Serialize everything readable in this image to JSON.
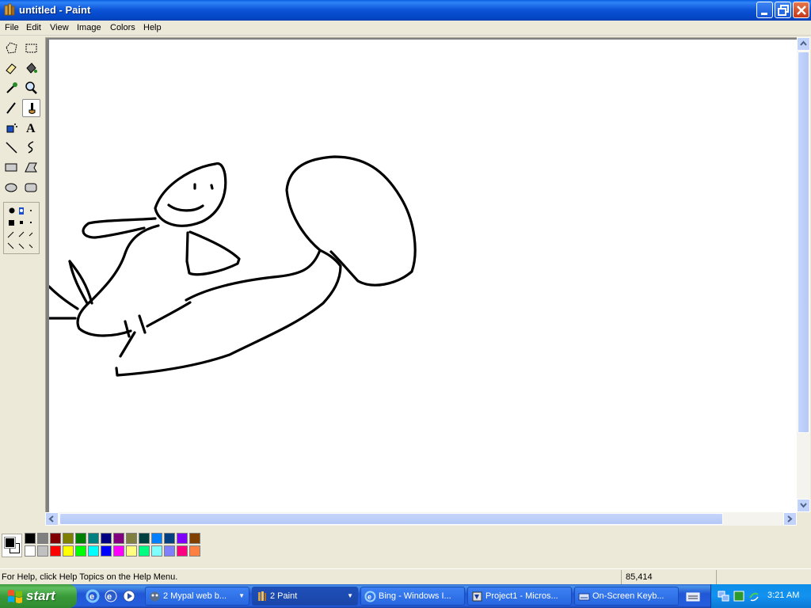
{
  "window": {
    "title": "untitled - Paint"
  },
  "menu": [
    "File",
    "Edit",
    "View",
    "Image",
    "Colors",
    "Help"
  ],
  "tools": [
    "free-form-select",
    "select",
    "eraser",
    "fill-with-color",
    "pick-color",
    "magnifier",
    "pencil",
    "brush",
    "airbrush",
    "text",
    "line",
    "curve",
    "rectangle",
    "polygon",
    "ellipse",
    "rounded-rectangle"
  ],
  "selected_tool": "brush",
  "palette": {
    "foreground": "#000000",
    "background": "#ffffff",
    "top_row": [
      "#000000",
      "#808080",
      "#800000",
      "#808000",
      "#008000",
      "#008080",
      "#000080",
      "#800080",
      "#808040",
      "#004040",
      "#0080ff",
      "#004080",
      "#8000ff",
      "#804000"
    ],
    "bottom_row": [
      "#ffffff",
      "#c0c0c0",
      "#ff0000",
      "#ffff00",
      "#00ff00",
      "#00ffff",
      "#0000ff",
      "#ff00ff",
      "#ffff80",
      "#00ff80",
      "#80ffff",
      "#8080ff",
      "#ff0080",
      "#ff8040"
    ]
  },
  "status": {
    "help": "For Help, click Help Topics on the Help Menu.",
    "coords": "85,414"
  },
  "taskbar": {
    "start_label": "start",
    "tasks": [
      {
        "label": "2 Mypal web b...",
        "icon": "mypal-icon",
        "has_group": true
      },
      {
        "label": "2 Paint",
        "icon": "paint-icon",
        "has_group": true,
        "active": true
      },
      {
        "label": "Bing - Windows I...",
        "icon": "ie-icon"
      },
      {
        "label": "Project1 - Micros...",
        "icon": "vb-icon"
      },
      {
        "label": "On-Screen Keyb...",
        "icon": "keyboard-icon"
      }
    ],
    "clock": "3:21 AM"
  }
}
